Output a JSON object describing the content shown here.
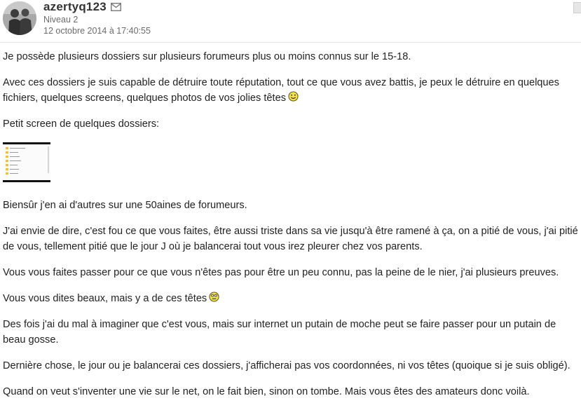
{
  "post": {
    "author": {
      "username": "azertyq123",
      "level": "Niveau 2",
      "date": "12 octobre 2014 à 17:40:55",
      "avatar_icon": "avatar-photo",
      "message_icon": "mail-icon"
    },
    "paragraphs": [
      "Je possède plusieurs dossiers sur plusieurs forumeurs plus ou moins connus sur le 15-18.",
      "Avec ces dossiers je suis capable de détruire toute réputation, tout ce que vous avez battis, je peux le détruire en quelques fichiers, quelques screens, quelques photos de vos jolies têtes",
      "Petit screen de quelques dossiers:",
      "Biensûr j'en ai d'autres sur une 50aines de forumeurs.",
      "J'ai envie de dire, c'est fou ce que vous faites, être aussi triste dans sa vie jusqu'à être ramené à ça, on a pitié de vous, j'ai pitié de vous, tellement pitié que le jour J où je balancerai tout vous irez pleurer chez vos parents.",
      "Vous vous faites passer pour ce que vous n'êtes pas pour être un peu connu, pas la peine de le nier, j'ai plusieurs preuves.",
      "Vous vous dites beaux, mais y a de ces têtes",
      "Des fois j'ai du mal à imaginer que c'est vous, mais sur internet un putain de moche peut se faire passer pour un putain de beau gosse.",
      "Dernière chose, le jour ou je balancerai ces dossiers, j'afficherai pas vos coordonnées, ni vos têtes (quoique si je suis obligé).",
      "Quand on veut s'inventer une vie sur le net, on le fait bien, sinon on tombe. Mais vous êtes des amateurs donc voilà."
    ],
    "thumbnail": {
      "icon": "folder-list-screenshot",
      "items": [
        "Affaires",
        "Dossiers",
        "Fichiers",
        "Screens",
        "Photos",
        "Preuves",
        "Forumeurs"
      ]
    },
    "smileys": [
      "smiley-happy",
      "smiley-weird"
    ]
  },
  "colors": {
    "text": "#222222",
    "meta": "#6b6b6b",
    "smiley_fill": "#f5e14a",
    "folder": "#e8c04a"
  }
}
